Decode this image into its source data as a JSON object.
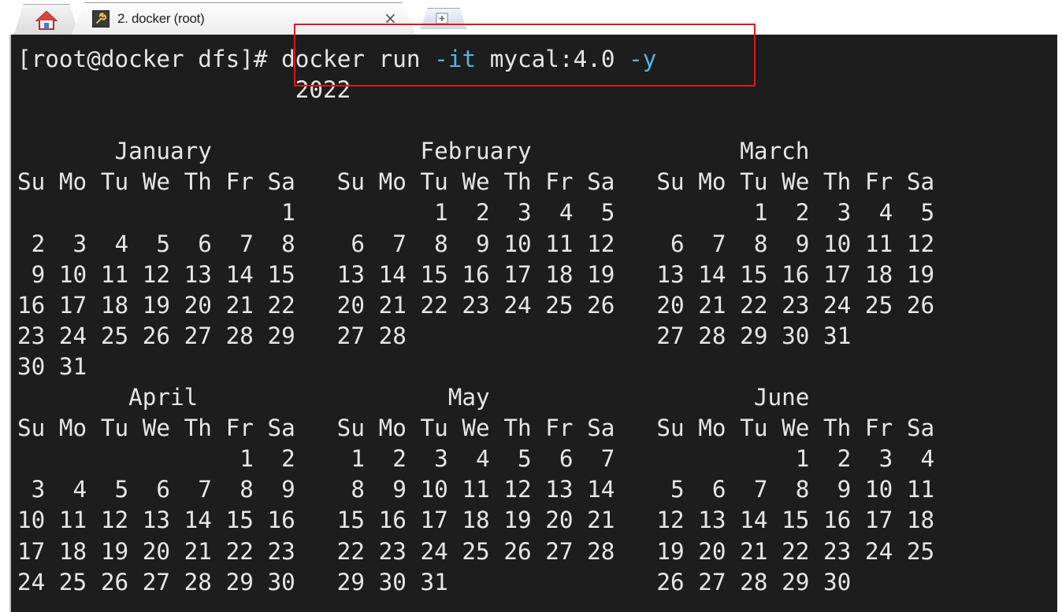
{
  "tabs": {
    "home_icon": "home-icon",
    "session_title": "2. docker (root)",
    "session_icon": "wrench-icon",
    "close_symbol": "×",
    "new_tab_icon": "new-tab-icon"
  },
  "terminal": {
    "prompt": "[root@docker dfs]#",
    "command": "docker run",
    "flag_it": "-it",
    "image": "mycal:4.0",
    "flag_y": "-y",
    "year_line": "2022",
    "calendar_lines": [
      "",
      "       January               February               March",
      "Su Mo Tu We Th Fr Sa   Su Mo Tu We Th Fr Sa   Su Mo Tu We Th Fr Sa",
      "                   1          1  2  3  4  5          1  2  3  4  5",
      " 2  3  4  5  6  7  8    6  7  8  9 10 11 12    6  7  8  9 10 11 12",
      " 9 10 11 12 13 14 15   13 14 15 16 17 18 19   13 14 15 16 17 18 19",
      "16 17 18 19 20 21 22   20 21 22 23 24 25 26   20 21 22 23 24 25 26",
      "23 24 25 26 27 28 29   27 28                  27 28 29 30 31",
      "30 31",
      "        April                  May                   June",
      "Su Mo Tu We Th Fr Sa   Su Mo Tu We Th Fr Sa   Su Mo Tu We Th Fr Sa",
      "                1  2    1  2  3  4  5  6  7             1  2  3  4",
      " 3  4  5  6  7  8  9    8  9 10 11 12 13 14    5  6  7  8  9 10 11",
      "10 11 12 13 14 15 16   15 16 17 18 19 20 21   12 13 14 15 16 17 18",
      "17 18 19 20 21 22 23   22 23 24 25 26 27 28   19 20 21 22 23 24 25",
      "24 25 26 27 28 29 30   29 30 31               26 27 28 29 30"
    ]
  },
  "colors": {
    "terminal_bg": "#1d1d1d",
    "terminal_fg": "#e6e6e6",
    "option_color": "#4fb7e6",
    "highlight_border": "#e0161b"
  }
}
